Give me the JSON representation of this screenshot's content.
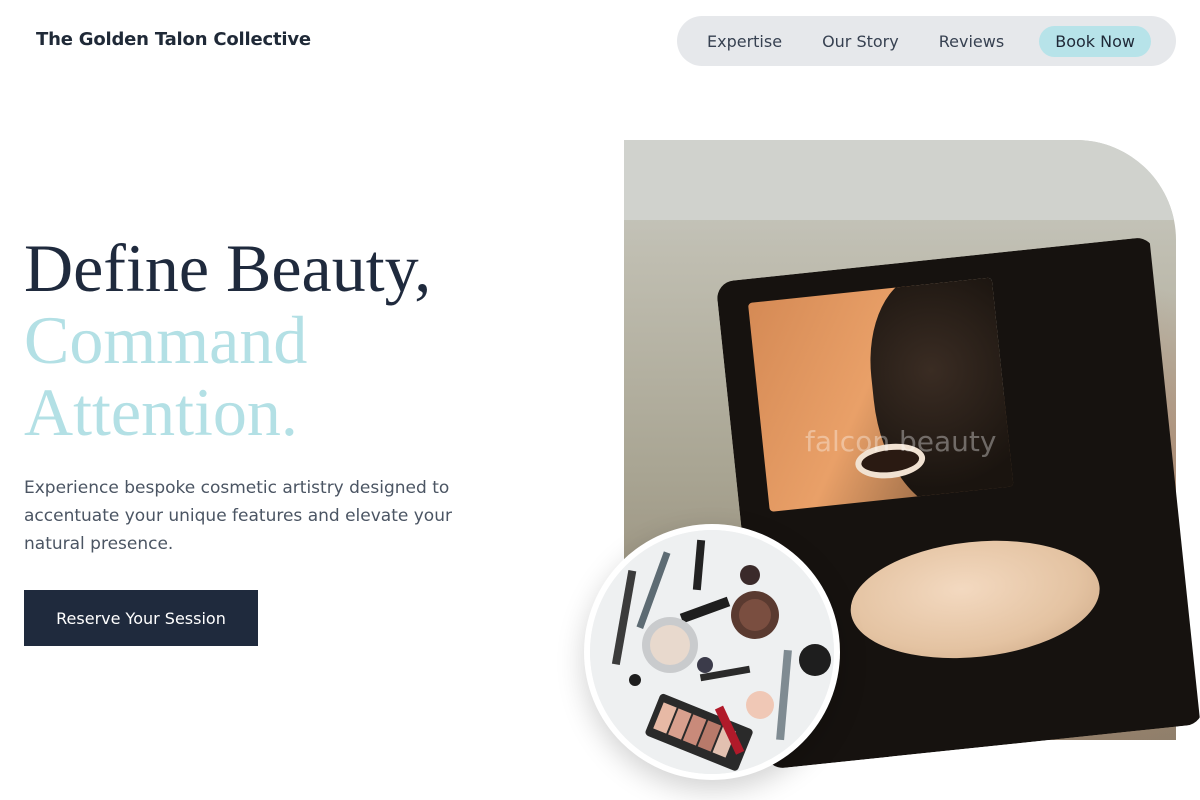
{
  "header": {
    "brand": "The Golden Talon Collective",
    "nav": {
      "links": [
        "Expertise",
        "Our Story",
        "Reviews"
      ],
      "cta": "Book Now"
    }
  },
  "hero": {
    "headline_line1": "Define Beauty,",
    "headline_line2": "Command",
    "headline_line3": "Attention.",
    "description": "Experience bespoke cosmetic artistry designed to accentuate your unique features and elevate your natural presence.",
    "cta": "Reserve Your Session",
    "image_watermark": "falcon beauty"
  },
  "colors": {
    "brand_dark": "#1f2a3d",
    "accent": "#b3e0e5",
    "nav_bg": "#e6e8eb",
    "nav_cta_bg": "#b7e3e9"
  }
}
